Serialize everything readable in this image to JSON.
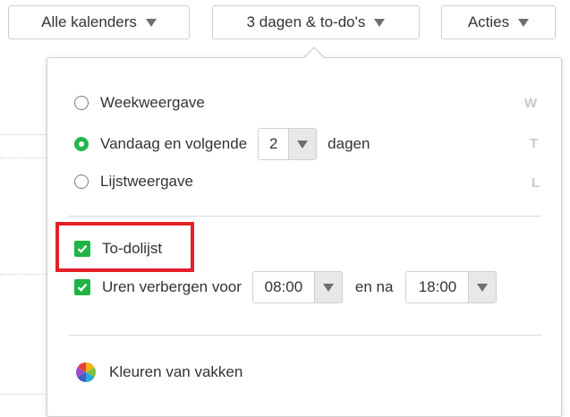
{
  "toolbar": {
    "calendars_label": "Alle kalenders",
    "view_label": "3 dagen & to-do's",
    "actions_label": "Acties"
  },
  "view_menu": {
    "week_label": "Weekweergave",
    "week_key": "W",
    "today_label": "Vandaag en volgende",
    "days_value": "2",
    "days_suffix": "dagen",
    "today_key": "T",
    "list_label": "Lijstweergave",
    "list_key": "L",
    "selected_view": "today",
    "todo_label": "To-dolijst",
    "todo_checked": true,
    "hide_hours_label": "Uren verbergen voor",
    "hide_hours_checked": true,
    "hide_from_value": "08:00",
    "and_after_label": "en na",
    "hide_to_value": "18:00",
    "colors_label": "Kleuren van vakken"
  },
  "colors": {
    "accent_green": "#20b84a",
    "highlight_red": "#e4202a"
  }
}
